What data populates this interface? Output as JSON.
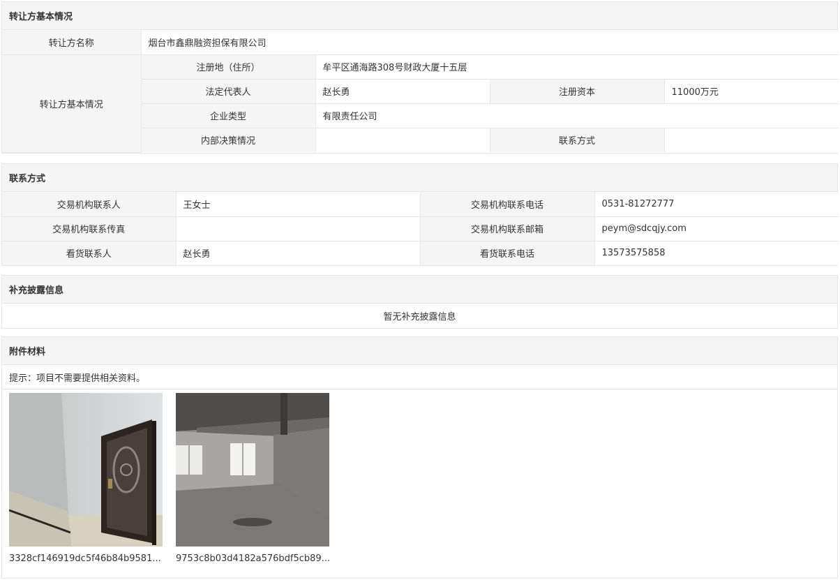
{
  "transferor": {
    "section_title": "转让方基本情况",
    "name_label": "转让方名称",
    "name_value": "烟台市鑫鼎融资担保有限公司",
    "basic_label": "转让方基本情况",
    "address_label": "注册地（住所）",
    "address_value": "牟平区通海路308号财政大厦十五层",
    "legal_rep_label": "法定代表人",
    "legal_rep_value": "赵长勇",
    "capital_label": "注册资本",
    "capital_value": "11000万元",
    "type_label": "企业类型",
    "type_value": "有限责任公司",
    "decision_label": "内部决策情况",
    "decision_value": "",
    "contact_label": "联系方式",
    "contact_value": ""
  },
  "contact": {
    "section_title": "联系方式",
    "agency_contact_label": "交易机构联系人",
    "agency_contact_value": "王女士",
    "agency_phone_label": "交易机构联系电话",
    "agency_phone_value": "0531-81272777",
    "agency_fax_label": "交易机构联系传真",
    "agency_fax_value": "",
    "agency_email_label": "交易机构联系邮箱",
    "agency_email_value": "peym@sdcqjy.com",
    "viewing_contact_label": "看货联系人",
    "viewing_contact_value": "赵长勇",
    "viewing_phone_label": "看货联系电话",
    "viewing_phone_value": "13573575858"
  },
  "supplement": {
    "section_title": "补充披露信息",
    "empty_text": "暂无补充披露信息"
  },
  "attachments": {
    "section_title": "附件材料",
    "tip": "提示：项目不需要提供相关资料。",
    "files": [
      {
        "caption": "3328cf146919dc5f46b84b9581..."
      },
      {
        "caption": "9753c8b03d4182a576bdf5cb89..."
      }
    ]
  }
}
